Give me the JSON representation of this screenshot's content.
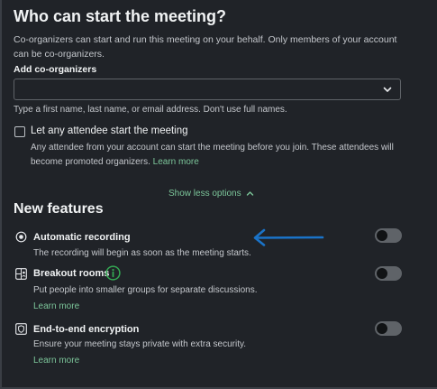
{
  "header": {
    "title": "Who can start the meeting?",
    "description": "Co-organizers can start and run this meeting on your behalf. Only members of your account can be co-organizers."
  },
  "coorganizers": {
    "label": "Add co-organizers",
    "value": "",
    "dropdown_icon": "chevron-down-icon",
    "hint": "Type a first name, last name, or email address. Don't use full names."
  },
  "attendee_start": {
    "checked": false,
    "label": "Let any attendee start the meeting",
    "description": "Any attendee from your account can start the meeting before you join. These attendees will become promoted organizers.",
    "learn_more": "Learn more"
  },
  "toggle_options": {
    "label": "Show less options",
    "icon": "chevron-up-icon"
  },
  "features": {
    "title": "New features",
    "items": [
      {
        "icon": "record-icon",
        "title": "Automatic recording",
        "description": "The recording will begin as soon as the meeting starts.",
        "learn_more": "",
        "enabled": false
      },
      {
        "icon": "breakout-rooms-icon",
        "title": "Breakout rooms",
        "badge_icon": "info-icon",
        "description": "Put people into smaller groups for separate discussions.",
        "learn_more": "Learn more",
        "enabled": false
      },
      {
        "icon": "shield-icon",
        "title": "End-to-end encryption",
        "description": "Ensure your meeting stays private with extra security.",
        "learn_more": "Learn more",
        "enabled": false
      }
    ]
  },
  "annotation": {
    "icon": "arrow-left-icon",
    "color": "#1a73c8"
  },
  "colors": {
    "background": "#202328",
    "link": "#7cc69a",
    "accent_green": "#34a853"
  }
}
